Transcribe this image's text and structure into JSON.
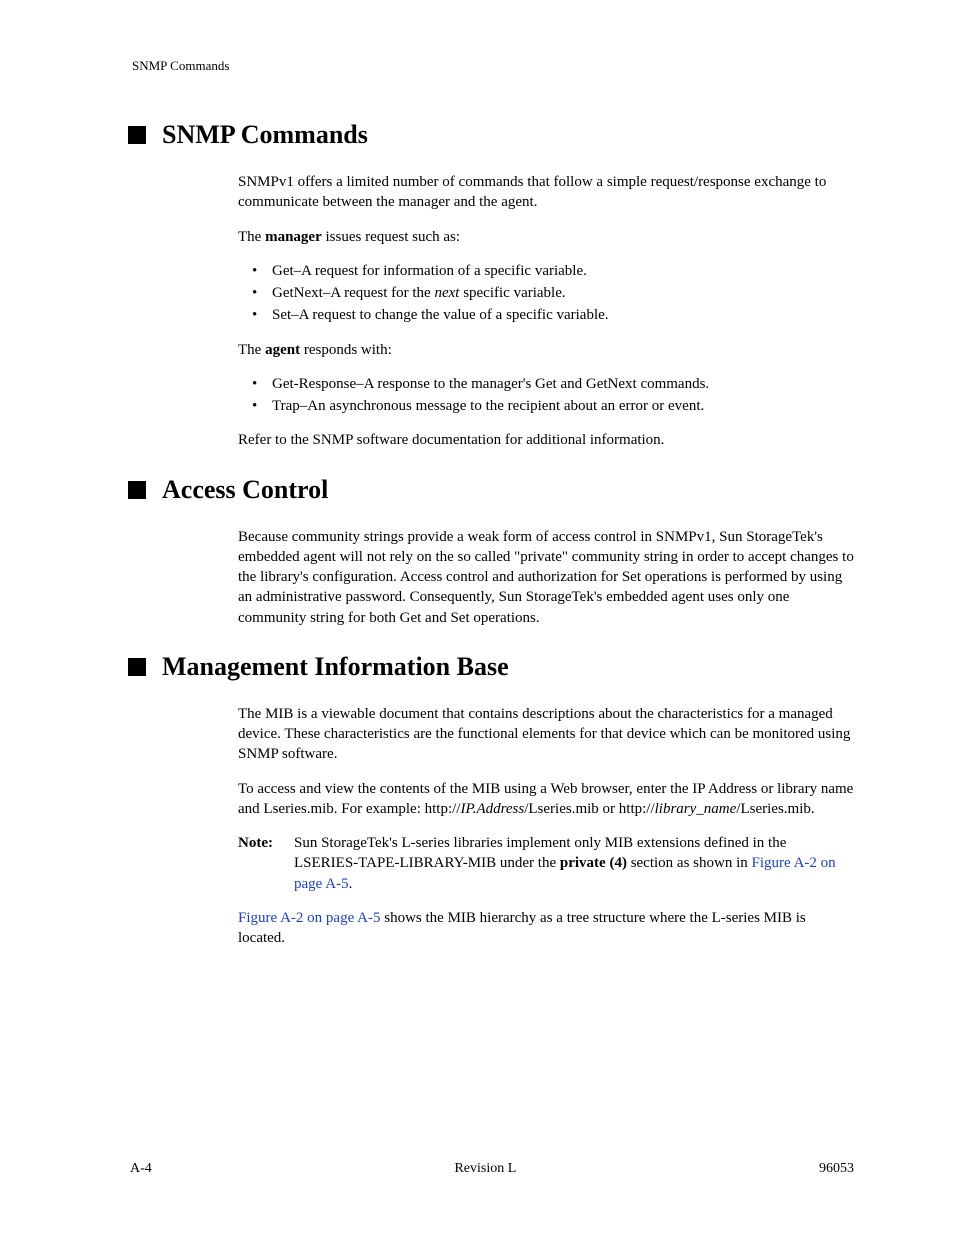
{
  "running_head": "SNMP Commands",
  "sections": {
    "snmp": {
      "title": "SNMP Commands",
      "intro": "SNMPv1 offers a limited number of commands that follow a simple request/response exchange to communicate between the manager and the agent.",
      "manager_line_pre": "The ",
      "manager_bold": "manager",
      "manager_line_post": " issues request such as:",
      "manager_items": [
        {
          "pre": "Get–A request for information of a specific variable.",
          "italic": "",
          "post": ""
        },
        {
          "pre": "GetNext–A request for the ",
          "italic": "next",
          "post": " specific variable."
        },
        {
          "pre": "Set–A request to change the value of a specific variable.",
          "italic": "",
          "post": ""
        }
      ],
      "agent_line_pre": "The ",
      "agent_bold": "agent",
      "agent_line_post": " responds with:",
      "agent_items": [
        "Get-Response–A response to the manager's Get and GetNext commands.",
        "Trap–An asynchronous message to the recipient about an error or event."
      ],
      "tail": "Refer to the SNMP software documentation for additional information."
    },
    "access": {
      "title": "Access Control",
      "body": "Because community strings provide a weak form of access control in SNMPv1, Sun StorageTek's embedded agent will not rely on the so called \"private\" community string in order to accept changes to the library's configuration. Access control and authorization for Set operations is performed by using an administrative password. Consequently, Sun StorageTek's embedded agent uses only one community string for both Get and Set operations."
    },
    "mib": {
      "title": "Management Information Base",
      "p1": "The MIB is a viewable document that contains descriptions about the characteristics for a managed device. These characteristics are the functional elements for that device which can be monitored using SNMP software.",
      "p2_pre": "To access and view the contents of the MIB using a Web browser, enter the IP Address or library name and Lseries.mib. For example: http://",
      "p2_ital1": "IP.Address",
      "p2_mid": "/Lseries.mib  or  http://",
      "p2_ital2": "library_name",
      "p2_post": "/Lseries.mib.",
      "note_label": "Note:",
      "note_pre": "Sun StorageTek's L-series libraries implement only MIB extensions defined in the LSERIES-TAPE-LIBRARY-MIB under the ",
      "note_bold": "private (4)",
      "note_mid": " section as shown in ",
      "note_link": "Figure A-2 on page A-5",
      "note_post": ".",
      "p3_link": "Figure A-2 on page A-5",
      "p3_post": " shows the MIB hierarchy as a tree structure where the L‑series MIB is located."
    }
  },
  "footer": {
    "left": "A-4",
    "center": "Revision L",
    "right": "96053"
  }
}
